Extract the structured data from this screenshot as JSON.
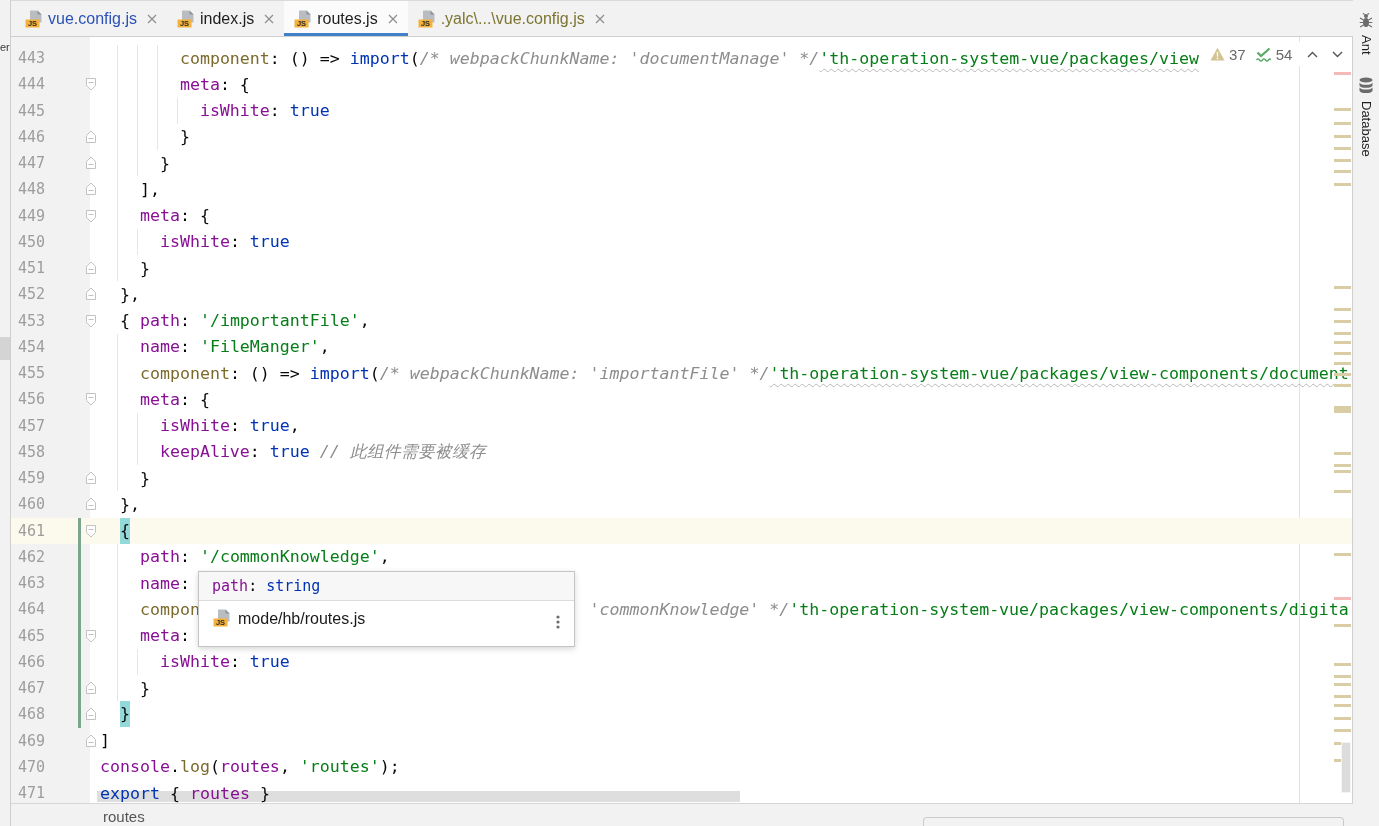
{
  "left_panel": {
    "text": "er"
  },
  "tabs": [
    {
      "label": "vue.config.js",
      "badge": "JS",
      "selected": false,
      "color": "#2a52b8"
    },
    {
      "label": "index.js",
      "badge": "JS",
      "selected": false,
      "color": "#1e1e1e"
    },
    {
      "label": "routes.js",
      "badge": "JS",
      "selected": true,
      "color": "#1e1e1e"
    },
    {
      "label": ".yalc\\...\\vue.config.js",
      "badge": "JS",
      "selected": false,
      "color": "#7d7530"
    }
  ],
  "inspections": {
    "warnings": "37",
    "typos": "54"
  },
  "lines": [
    {
      "children": [
        {
          "children": [
            {
              "children": [
                {
                  "children": [
                    {
                      "number": "443",
                      "tokens": [
                        {
                          "kind": "method",
                          "text": "component"
                        },
                        {
                          "kind": "plain",
                          "text": ": () => "
                        },
                        {
                          "kind": "keyword",
                          "text": "import"
                        },
                        {
                          "kind": "plain",
                          "text": "("
                        },
                        {
                          "kind": "comment",
                          "text": "/* webpackChunkName: 'documentManage' */"
                        },
                        {
                          "kind": "flagged",
                          "text": "'th-operation-system-vue/packages/view"
                        }
                      ],
                      "current": false,
                      "changed": false
                    },
                    {
                      "number": "444",
                      "kind": "open",
                      "tokens": [
                        {
                          "kind": "prop",
                          "text": "meta"
                        },
                        {
                          "kind": "plain",
                          "text": ": {"
                        }
                      ],
                      "current": false,
                      "changed": false,
                      "children": [
                        {
                          "number": "445",
                          "tokens": [
                            {
                              "kind": "prop",
                              "text": "isWhite"
                            },
                            {
                              "kind": "plain",
                              "text": ": "
                            },
                            {
                              "kind": "keyword",
                              "text": "true"
                            }
                          ],
                          "current": false,
                          "changed": false
                        }
                      ]
                    },
                    {
                      "number": "446",
                      "kind": "close",
                      "tokens": [
                        {
                          "kind": "plain",
                          "text": "}"
                        }
                      ],
                      "current": false,
                      "changed": false
                    }
                  ]
                },
                {
                  "number": "447",
                  "kind": "close",
                  "tokens": [
                    {
                      "kind": "plain",
                      "text": "}"
                    }
                  ],
                  "current": false,
                  "changed": false
                }
              ]
            },
            {
              "number": "448",
              "kind": "close",
              "tokens": [
                {
                  "kind": "plain",
                  "text": "],"
                }
              ],
              "current": false,
              "changed": false
            },
            {
              "number": "449",
              "kind": "open",
              "tokens": [
                {
                  "kind": "prop",
                  "text": "meta"
                },
                {
                  "kind": "plain",
                  "text": ": {"
                }
              ],
              "current": false,
              "changed": false,
              "children": [
                {
                  "number": "450",
                  "tokens": [
                    {
                      "kind": "prop",
                      "text": "isWhite"
                    },
                    {
                      "kind": "plain",
                      "text": ": "
                    },
                    {
                      "kind": "keyword",
                      "text": "true"
                    }
                  ],
                  "current": false,
                  "changed": false
                }
              ]
            },
            {
              "number": "451",
              "kind": "close",
              "tokens": [
                {
                  "kind": "plain",
                  "text": "}"
                }
              ],
              "current": false,
              "changed": false
            }
          ]
        },
        {
          "number": "452",
          "kind": "close",
          "tokens": [
            {
              "kind": "plain",
              "text": "},"
            }
          ],
          "current": false,
          "changed": false
        },
        {
          "number": "453",
          "kind": "open",
          "tokens": [
            {
              "kind": "plain",
              "text": "{ "
            },
            {
              "kind": "prop",
              "text": "path"
            },
            {
              "kind": "plain",
              "text": ": "
            },
            {
              "kind": "string",
              "text": "'/importantFile'"
            },
            {
              "kind": "plain",
              "text": ","
            }
          ],
          "current": false,
          "changed": false,
          "children": [
            {
              "number": "454",
              "tokens": [
                {
                  "kind": "prop",
                  "text": "name"
                },
                {
                  "kind": "plain",
                  "text": ": "
                },
                {
                  "kind": "string",
                  "text": "'FileManger'"
                },
                {
                  "kind": "plain",
                  "text": ","
                }
              ],
              "current": false,
              "changed": false
            },
            {
              "number": "455",
              "tokens": [
                {
                  "kind": "method",
                  "text": "component"
                },
                {
                  "kind": "plain",
                  "text": ": () => "
                },
                {
                  "kind": "keyword",
                  "text": "import"
                },
                {
                  "kind": "plain",
                  "text": "("
                },
                {
                  "kind": "comment",
                  "text": "/* webpackChunkName: 'importantFile' */"
                },
                {
                  "kind": "flagged",
                  "text": "'th-operation-system-vue/packages/view-components/document"
                }
              ],
              "current": false,
              "changed": false
            },
            {
              "number": "456",
              "kind": "open",
              "tokens": [
                {
                  "kind": "prop",
                  "text": "meta"
                },
                {
                  "kind": "plain",
                  "text": ": {"
                }
              ],
              "current": false,
              "changed": false,
              "children": [
                {
                  "number": "457",
                  "tokens": [
                    {
                      "kind": "prop",
                      "text": "isWhite"
                    },
                    {
                      "kind": "plain",
                      "text": ": "
                    },
                    {
                      "kind": "keyword",
                      "text": "true"
                    },
                    {
                      "kind": "plain",
                      "text": ","
                    }
                  ],
                  "current": false,
                  "changed": false
                },
                {
                  "number": "458",
                  "tokens": [
                    {
                      "kind": "prop",
                      "text": "keepAlive"
                    },
                    {
                      "kind": "plain",
                      "text": ": "
                    },
                    {
                      "kind": "keyword",
                      "text": "true"
                    },
                    {
                      "kind": "comment",
                      "text": " // 此组件需要被缓存"
                    }
                  ],
                  "current": false,
                  "changed": false
                }
              ]
            },
            {
              "number": "459",
              "kind": "close",
              "tokens": [
                {
                  "kind": "plain",
                  "text": "}"
                }
              ],
              "current": false,
              "changed": false
            }
          ]
        },
        {
          "number": "460",
          "kind": "close",
          "tokens": [
            {
              "kind": "plain",
              "text": "},"
            }
          ],
          "current": false,
          "changed": false
        },
        {
          "number": "461",
          "kind": "open",
          "tokens": [
            {
              "kind": "matched",
              "text": "{"
            }
          ],
          "current": true,
          "changed": true,
          "children": [
            {
              "number": "462",
              "tokens": [
                {
                  "kind": "prop",
                  "text": "path"
                },
                {
                  "kind": "plain",
                  "text": ": "
                },
                {
                  "kind": "string",
                  "text": "'/commonKnowledge'"
                },
                {
                  "kind": "plain",
                  "text": ","
                }
              ],
              "current": false,
              "changed": true
            },
            {
              "number": "463",
              "tokens": [
                {
                  "kind": "prop",
                  "text": "name"
                },
                {
                  "kind": "plain",
                  "text": ":"
                }
              ],
              "current": false,
              "changed": true
            },
            {
              "number": "464",
              "tokens": [
                {
                  "kind": "method",
                  "text": "compon"
                }
              ],
              "after_popup": [
                {
                  "kind": "comment",
                  "text": "'commonKnowledge' */"
                },
                {
                  "kind": "string",
                  "text": "'th-operation-system-vue/packages/view-components/digita"
                }
              ],
              "current": false,
              "changed": true
            },
            {
              "number": "465",
              "kind": "open",
              "tokens": [
                {
                  "kind": "prop",
                  "text": "meta"
                },
                {
                  "kind": "plain",
                  "text": ":"
                }
              ],
              "current": false,
              "changed": true,
              "children": [
                {
                  "number": "466",
                  "tokens": [
                    {
                      "kind": "prop",
                      "text": "isWhite"
                    },
                    {
                      "kind": "plain",
                      "text": ": "
                    },
                    {
                      "kind": "keyword",
                      "text": "true"
                    }
                  ],
                  "current": false,
                  "changed": true
                }
              ]
            },
            {
              "number": "467",
              "kind": "close",
              "tokens": [
                {
                  "kind": "plain",
                  "text": "}"
                }
              ],
              "current": false,
              "changed": true
            }
          ]
        },
        {
          "number": "468",
          "kind": "close",
          "tokens": [
            {
              "kind": "matched",
              "text": "}"
            }
          ],
          "current": false,
          "changed": true
        }
      ]
    },
    {
      "number": "469",
      "kind": "close",
      "tokens": [
        {
          "kind": "plain",
          "text": "]"
        }
      ],
      "current": false,
      "changed": false
    },
    {
      "number": "470",
      "tokens": [
        {
          "kind": "prop",
          "text": "console"
        },
        {
          "kind": "plain",
          "text": "."
        },
        {
          "kind": "method",
          "text": "log"
        },
        {
          "kind": "plain",
          "text": "("
        },
        {
          "kind": "prop",
          "text": "routes"
        },
        {
          "kind": "plain",
          "text": ", "
        },
        {
          "kind": "string",
          "text": "'routes'"
        },
        {
          "kind": "plain",
          "text": ");"
        }
      ],
      "current": false,
      "changed": false
    },
    {
      "number": "471",
      "tokens": [
        {
          "kind": "keyword",
          "text": "export"
        },
        {
          "kind": "plain",
          "text": " { "
        },
        {
          "kind": "prop",
          "text": "routes"
        },
        {
          "kind": "plain",
          "text": " }"
        }
      ],
      "current": false,
      "changed": false
    }
  ],
  "popup": {
    "signature": [
      {
        "kind": "prop",
        "text": "path"
      },
      {
        "kind": "plain",
        "text": ": "
      },
      {
        "kind": "keyword",
        "text": "string"
      }
    ],
    "badge": "JS",
    "file": "mode/hb/routes.js"
  },
  "breadcrumb": [
    "routes"
  ],
  "tool_windows": [
    {
      "kind": "ant",
      "label": "Ant"
    },
    {
      "kind": "database",
      "label": "Database"
    }
  ]
}
